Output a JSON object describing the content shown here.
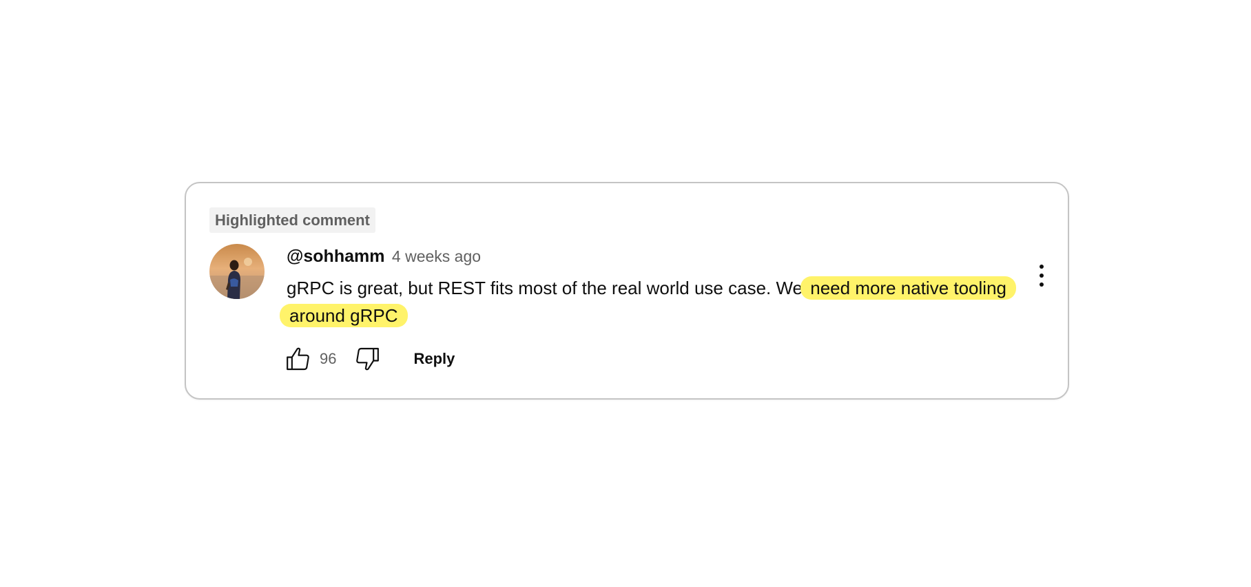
{
  "badge": {
    "label": "Highlighted comment"
  },
  "comment": {
    "author": "@sohhamm",
    "time": "4 weeks ago",
    "text_plain": "gRPC is great, but REST fits most of the real world use case. We",
    "text_highlighted": "need more native tooling around gRPC",
    "like_count": "96",
    "reply_label": "Reply"
  },
  "icons": {
    "avatar": "user-avatar-photo",
    "like": "thumbs-up-icon",
    "dislike": "thumbs-down-icon",
    "more": "more-vertical-icon"
  },
  "colors": {
    "highlight": "#fff36a",
    "text": "#0f0f0f",
    "secondary_text": "#606060",
    "border": "#c4c4c4"
  }
}
